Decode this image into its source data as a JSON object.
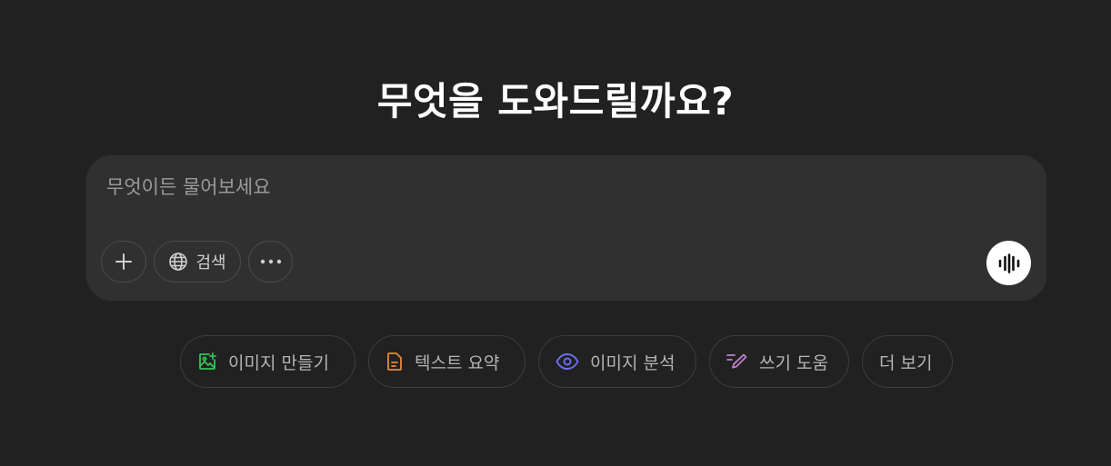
{
  "heading": "무엇을 도와드릴까요?",
  "composer": {
    "placeholder": "무엇이든 물어보세요",
    "value": "",
    "add_icon": "plus-icon",
    "search_icon": "globe-icon",
    "search_label": "검색",
    "more_icon": "ellipsis-icon",
    "voice_icon": "voice-waveform-icon"
  },
  "suggestions": [
    {
      "label": "이미지 만들기",
      "icon": "image-create-icon",
      "color": "#36c25a"
    },
    {
      "label": "텍스트 요약",
      "icon": "document-icon",
      "color": "#e8883a"
    },
    {
      "label": "이미지 분석",
      "icon": "eye-icon",
      "color": "#6f6dee"
    },
    {
      "label": "쓰기 도움",
      "icon": "pen-icon",
      "color": "#c07fd0"
    },
    {
      "label": "더 보기",
      "icon": "",
      "color": ""
    }
  ],
  "colors": {
    "background": "#212121",
    "composer": "#303030",
    "voice_button": "#ffffff"
  }
}
